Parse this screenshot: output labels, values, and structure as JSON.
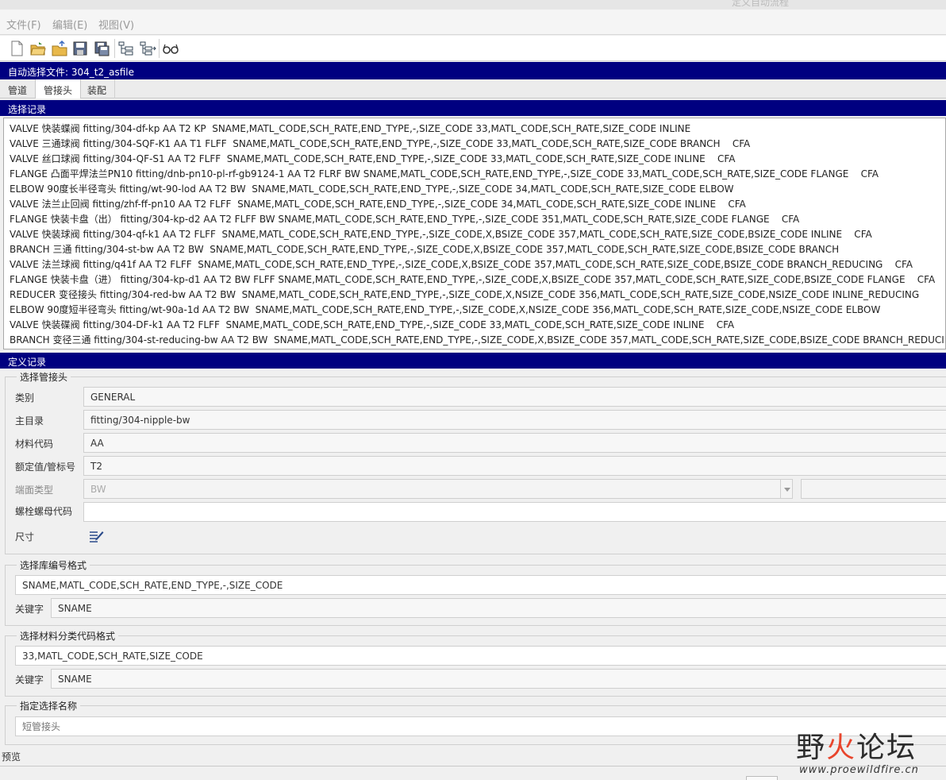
{
  "titlebar": {
    "ghost_text": "定义自动流程"
  },
  "menu": [
    "文件(F)",
    "编辑(E)",
    "视图(V)"
  ],
  "toolbar_icons": [
    "new-file-icon",
    "open-folder-icon",
    "open-icon",
    "save-icon",
    "save-as-icon",
    "tree-expand-icon",
    "tree-collapse-icon",
    "glasses-icon"
  ],
  "file_header": "自动选择文件: 304_t2_asfile",
  "tabs": [
    {
      "label": "管道",
      "active": false
    },
    {
      "label": "管接头",
      "active": true
    },
    {
      "label": "装配",
      "active": false
    }
  ],
  "select_records": {
    "title": "选择记录",
    "rows": [
      "VALVE 快装蝶阀 fitting/304-df-kp AA T2 KP  SNAME,MATL_CODE,SCH_RATE,END_TYPE,-,SIZE_CODE 33,MATL_CODE,SCH_RATE,SIZE_CODE INLINE",
      "VALVE 三通球阀 fitting/304-SQF-K1 AA T1 FLFF  SNAME,MATL_CODE,SCH_RATE,END_TYPE,-,SIZE_CODE 33,MATL_CODE,SCH_RATE,SIZE_CODE BRANCH    CFA",
      "VALVE 丝口球阀 fitting/304-QF-S1 AA T2 FLFF  SNAME,MATL_CODE,SCH_RATE,END_TYPE,-,SIZE_CODE 33,MATL_CODE,SCH_RATE,SIZE_CODE INLINE    CFA",
      "FLANGE 凸面平焊法兰PN10 fitting/dnb-pn10-pl-rf-gb9124-1 AA T2 FLRF BW SNAME,MATL_CODE,SCH_RATE,END_TYPE,-,SIZE_CODE 33,MATL_CODE,SCH_RATE,SIZE_CODE FLANGE    CFA",
      "ELBOW 90度长半径弯头 fitting/wt-90-lod AA T2 BW  SNAME,MATL_CODE,SCH_RATE,END_TYPE,-,SIZE_CODE 34,MATL_CODE,SCH_RATE,SIZE_CODE ELBOW",
      "VALVE 法兰止回阀 fitting/zhf-ff-pn10 AA T2 FLFF  SNAME,MATL_CODE,SCH_RATE,END_TYPE,-,SIZE_CODE 34,MATL_CODE,SCH_RATE,SIZE_CODE INLINE    CFA",
      "FLANGE 快装卡盘（出） fitting/304-kp-d2 AA T2 FLFF BW SNAME,MATL_CODE,SCH_RATE,END_TYPE,-,SIZE_CODE 351,MATL_CODE,SCH_RATE,SIZE_CODE FLANGE    CFA",
      "VALVE 快装球阀 fitting/304-qf-k1 AA T2 FLFF  SNAME,MATL_CODE,SCH_RATE,END_TYPE,-,SIZE_CODE,X,BSIZE_CODE 357,MATL_CODE,SCH_RATE,SIZE_CODE,BSIZE_CODE INLINE    CFA",
      "BRANCH 三通 fitting/304-st-bw AA T2 BW  SNAME,MATL_CODE,SCH_RATE,END_TYPE,-,SIZE_CODE,X,BSIZE_CODE 357,MATL_CODE,SCH_RATE,SIZE_CODE,BSIZE_CODE BRANCH",
      "VALVE 法兰球阀 fitting/q41f AA T2 FLFF  SNAME,MATL_CODE,SCH_RATE,END_TYPE,-,SIZE_CODE,X,BSIZE_CODE 357,MATL_CODE,SCH_RATE,SIZE_CODE,BSIZE_CODE BRANCH_REDUCING    CFA",
      "FLANGE 快装卡盘（进） fitting/304-kp-d1 AA T2 BW FLFF SNAME,MATL_CODE,SCH_RATE,END_TYPE,-,SIZE_CODE,X,BSIZE_CODE 357,MATL_CODE,SCH_RATE,SIZE_CODE,BSIZE_CODE FLANGE    CFA",
      "REDUCER 变径接头 fitting/304-red-bw AA T2 BW  SNAME,MATL_CODE,SCH_RATE,END_TYPE,-,SIZE_CODE,X,NSIZE_CODE 356,MATL_CODE,SCH_RATE,SIZE_CODE,NSIZE_CODE INLINE_REDUCING",
      "ELBOW 90度短半径弯头 fitting/wt-90a-1d AA T2 BW  SNAME,MATL_CODE,SCH_RATE,END_TYPE,-,SIZE_CODE,X,NSIZE_CODE 356,MATL_CODE,SCH_RATE,SIZE_CODE,NSIZE_CODE ELBOW",
      "VALVE 快装碟阀 fitting/304-DF-k1 AA T2 FLFF  SNAME,MATL_CODE,SCH_RATE,END_TYPE,-,SIZE_CODE 33,MATL_CODE,SCH_RATE,SIZE_CODE INLINE    CFA",
      "BRANCH 变径三通 fitting/304-st-reducing-bw AA T2 BW  SNAME,MATL_CODE,SCH_RATE,END_TYPE,-,SIZE_CODE,X,BSIZE_CODE 357,MATL_CODE,SCH_RATE,SIZE_CODE,BSIZE_CODE BRANCH_REDUCING"
    ]
  },
  "define_records": {
    "title": "定义记录",
    "select_fitting": {
      "group_label": "选择管接头",
      "category_label": "类别",
      "category_value": "GENERAL",
      "main_dir_label": "主目录",
      "main_dir_value": "fitting/304-nipple-bw",
      "material_label": "材料代码",
      "material_value": "AA",
      "rating_label": "额定值/管标号",
      "rating_value": "T2",
      "end_type_label": "端面类型",
      "end_type_value": "BW",
      "bolt_nut_label": "螺栓螺母代码",
      "bolt_nut_value": "",
      "size_label": "尺寸"
    },
    "lib_format": {
      "group_label": "选择库编号格式",
      "format_value": "SNAME,MATL_CODE,SCH_RATE,END_TYPE,-,SIZE_CODE",
      "keyword_label": "关键字",
      "keyword_value": "SNAME"
    },
    "material_format": {
      "group_label": "选择材料分类代码格式",
      "format_value": "33,MATL_CODE,SCH_RATE,SIZE_CODE",
      "keyword_label": "关键字",
      "keyword_value": "SNAME"
    },
    "select_name": {
      "group_label": "指定选择名称",
      "placeholder": "短管接头"
    }
  },
  "preview_label": "预览",
  "watermark": {
    "title_black": "野",
    "title_red": "火",
    "title_black2": "论坛",
    "url": "www.proewildfire.cn"
  },
  "colors": {
    "header_bg": "#000080",
    "watermark_red": "#e8452c"
  }
}
